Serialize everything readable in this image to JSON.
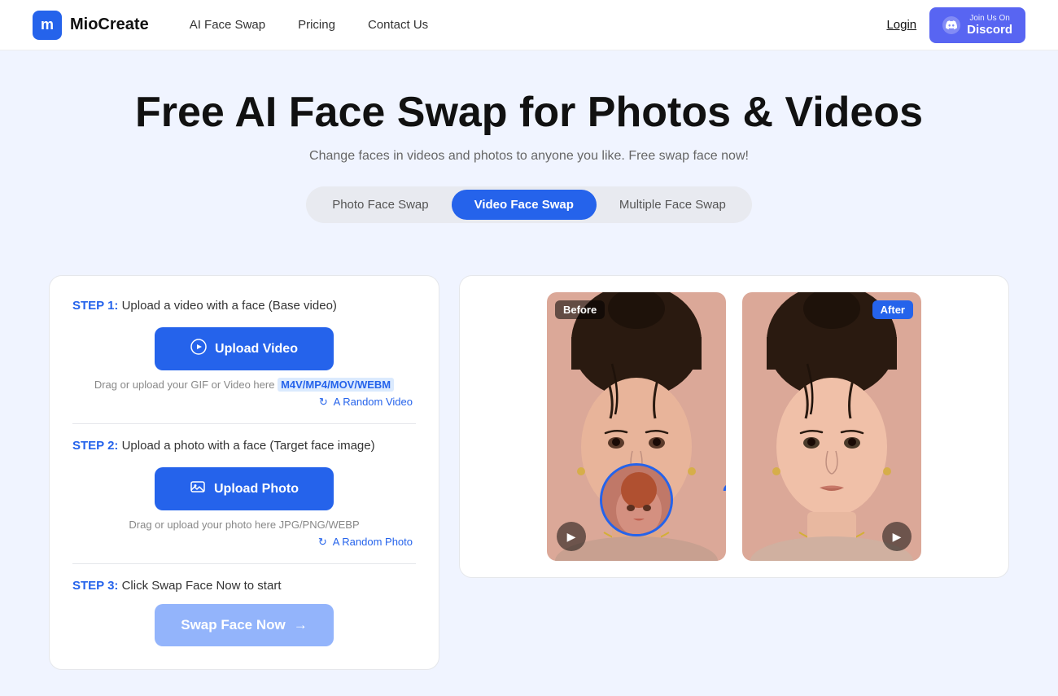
{
  "nav": {
    "logo_letter": "m",
    "logo_name": "MioCreate",
    "links": [
      {
        "id": "ai-face-swap",
        "label": "AI Face Swap"
      },
      {
        "id": "pricing",
        "label": "Pricing"
      },
      {
        "id": "contact-us",
        "label": "Contact Us"
      }
    ],
    "login_label": "Login",
    "discord": {
      "top": "Join Us On",
      "main": "Discord"
    }
  },
  "hero": {
    "title": "Free AI Face Swap for Photos & Videos",
    "subtitle": "Change faces in videos and photos to anyone you like. Free swap face now!"
  },
  "tabs": [
    {
      "id": "photo",
      "label": "Photo Face Swap",
      "active": false
    },
    {
      "id": "video",
      "label": "Video Face Swap",
      "active": true
    },
    {
      "id": "multiple",
      "label": "Multiple Face Swap",
      "active": false
    }
  ],
  "steps": {
    "step1_label": "STEP 1:",
    "step1_text": " Upload a video with a face (Base video)",
    "upload_video_label": "Upload Video",
    "drag_text_prefix": "Drag or upload your GIF or Video here ",
    "drag_highlight": "M4V/MP4/MOV/WEBM",
    "random_video_label": "A Random Video",
    "step2_label": "STEP 2:",
    "step2_text": " Upload a photo with a face (Target face image)",
    "upload_photo_label": "Upload Photo",
    "drag_photo_text": "Drag or upload your photo here JPG/PNG/WEBP",
    "random_photo_label": "A Random Photo",
    "step3_label": "STEP 3:",
    "step3_text": " Click Swap Face Now to start",
    "swap_btn_label": "Swap Face Now",
    "swap_btn_arrow": "→"
  },
  "preview": {
    "before_label": "Before",
    "after_label": "After"
  }
}
